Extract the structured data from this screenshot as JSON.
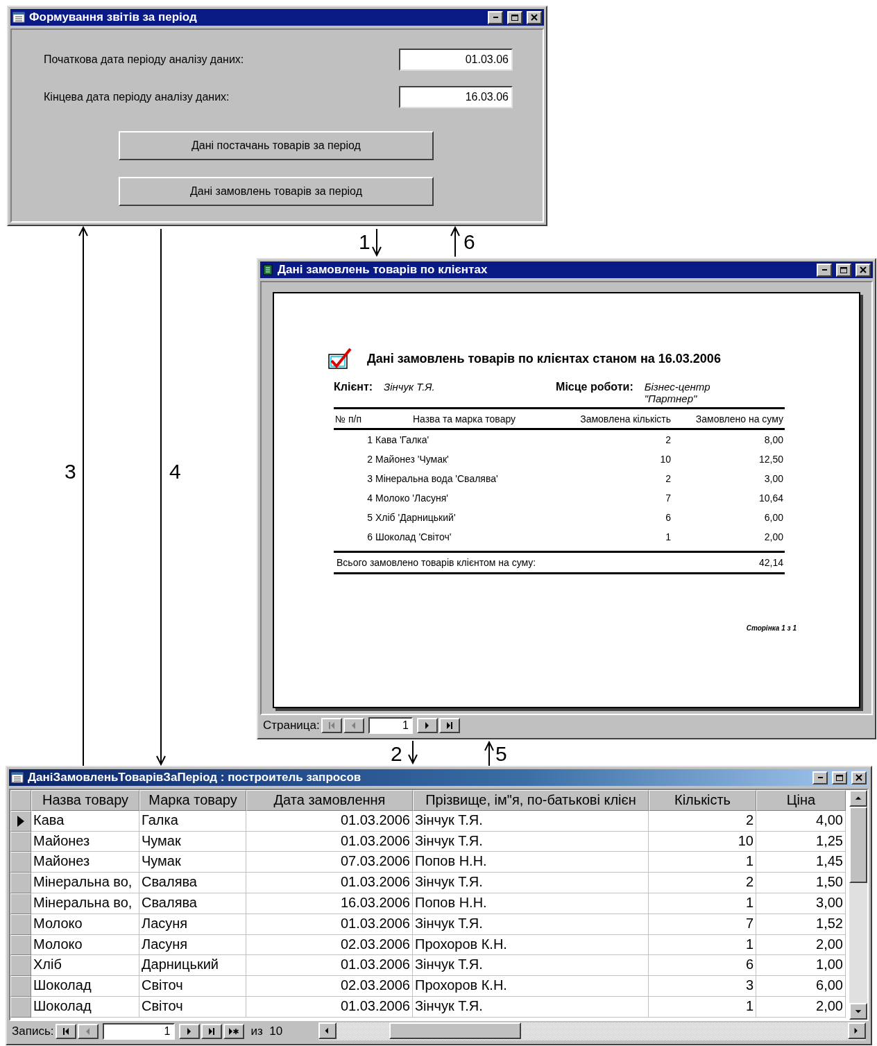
{
  "form_window": {
    "title": "Формування звітів за період",
    "fields": [
      {
        "label": "Початкова дата періоду аналізу даних:",
        "value": "01.03.06"
      },
      {
        "label": "Кінцева дата періоду аналізу даних:",
        "value": "16.03.06"
      }
    ],
    "buttons": [
      "Дані постачань товарів за період",
      "Дані замовлень товарів за період"
    ]
  },
  "report_window": {
    "title": "Дані замовлень товарів по клієнтах",
    "report": {
      "heading": "Дані замовлень товарів по клієнтах станом на 16.03.2006",
      "client_label": "Клієнт:",
      "client": "Зінчук Т.Я.",
      "workplace_label": "Місце роботи:",
      "workplace": "Бізнес-центр \"Партнер\"",
      "columns": [
        "№ п/п",
        "Назва та марка товару",
        "Замовлена кількість",
        "Замовлено на суму"
      ],
      "rows": [
        {
          "n": "1",
          "item": "Кава 'Галка'",
          "qty": "2",
          "sum": "8,00"
        },
        {
          "n": "2",
          "item": "Майонез 'Чумак'",
          "qty": "10",
          "sum": "12,50"
        },
        {
          "n": "3",
          "item": "Мінеральна вода 'Свалява'",
          "qty": "2",
          "sum": "3,00"
        },
        {
          "n": "4",
          "item": "Молоко 'Ласуня'",
          "qty": "7",
          "sum": "10,64"
        },
        {
          "n": "5",
          "item": "Хліб 'Дарницький'",
          "qty": "6",
          "sum": "6,00"
        },
        {
          "n": "6",
          "item": "Шоколад 'Світоч'",
          "qty": "1",
          "sum": "2,00"
        }
      ],
      "total_label": "Всього замовлено товарів клієнтом на суму:",
      "total": "42,14",
      "page_footer": "Сторінка 1 з 1"
    },
    "nav": {
      "label": "Страница:",
      "page": "1"
    }
  },
  "query_window": {
    "title": "ДаніЗамовленьТоварівЗаПеріод : построитель запросов",
    "columns": [
      "Назва товару",
      "Марка товару",
      "Дата замовлення",
      "Прізвище, ім\"я, по-батькові клієн",
      "Кількість",
      "Ціна"
    ],
    "rows": [
      {
        "selected": true,
        "cells": [
          "Кава",
          "Галка",
          "01.03.2006",
          "Зінчук Т.Я.",
          "2",
          "4,00"
        ]
      },
      {
        "selected": false,
        "cells": [
          "Майонез",
          "Чумак",
          "01.03.2006",
          "Зінчук Т.Я.",
          "10",
          "1,25"
        ]
      },
      {
        "selected": false,
        "cells": [
          "Майонез",
          "Чумак",
          "07.03.2006",
          "Попов Н.Н.",
          "1",
          "1,45"
        ]
      },
      {
        "selected": false,
        "cells": [
          "Мінеральна во,",
          "Свалява",
          "01.03.2006",
          "Зінчук Т.Я.",
          "2",
          "1,50"
        ]
      },
      {
        "selected": false,
        "cells": [
          "Мінеральна во,",
          "Свалява",
          "16.03.2006",
          "Попов Н.Н.",
          "1",
          "3,00"
        ]
      },
      {
        "selected": false,
        "cells": [
          "Молоко",
          "Ласуня",
          "01.03.2006",
          "Зінчук Т.Я.",
          "7",
          "1,52"
        ]
      },
      {
        "selected": false,
        "cells": [
          "Молоко",
          "Ласуня",
          "02.03.2006",
          "Прохоров К.Н.",
          "1",
          "2,00"
        ]
      },
      {
        "selected": false,
        "cells": [
          "Хліб",
          "Дарницький",
          "01.03.2006",
          "Зінчук Т.Я.",
          "6",
          "1,00"
        ]
      },
      {
        "selected": false,
        "cells": [
          "Шоколад",
          "Світоч",
          "02.03.2006",
          "Прохоров К.Н.",
          "3",
          "6,00"
        ]
      },
      {
        "selected": false,
        "cells": [
          "Шоколад",
          "Світоч",
          "01.03.2006",
          "Зінчук Т.Я.",
          "1",
          "2,00"
        ]
      }
    ],
    "nav": {
      "label": "Запись:",
      "record": "1",
      "count": "из  10"
    }
  },
  "arrows": [
    {
      "label": "1",
      "points_up": false
    },
    {
      "label": "2",
      "points_up": false
    },
    {
      "label": "3",
      "points_up": true
    },
    {
      "label": "4",
      "points_up": false
    },
    {
      "label": "5",
      "points_up": true
    },
    {
      "label": "6",
      "points_up": true
    }
  ]
}
